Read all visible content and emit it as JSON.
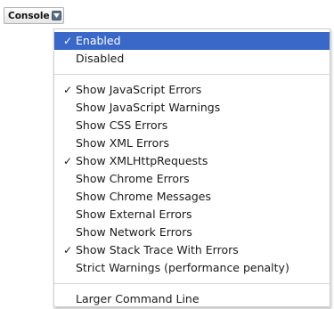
{
  "console_tab": {
    "label": "Console"
  },
  "menu": {
    "group1": [
      {
        "label": "Enabled",
        "checked": true,
        "highlighted": true
      },
      {
        "label": "Disabled",
        "checked": false
      }
    ],
    "group2": [
      {
        "label": "Show JavaScript Errors",
        "checked": true
      },
      {
        "label": "Show JavaScript Warnings",
        "checked": false
      },
      {
        "label": "Show CSS Errors",
        "checked": false
      },
      {
        "label": "Show XML Errors",
        "checked": false
      },
      {
        "label": "Show XMLHttpRequests",
        "checked": true
      },
      {
        "label": "Show Chrome Errors",
        "checked": false
      },
      {
        "label": "Show Chrome Messages",
        "checked": false
      },
      {
        "label": "Show External Errors",
        "checked": false
      },
      {
        "label": "Show Network Errors",
        "checked": false
      },
      {
        "label": "Show Stack Trace With Errors",
        "checked": true
      },
      {
        "label": "Strict Warnings (performance penalty)",
        "checked": false
      }
    ],
    "group3": [
      {
        "label": "Larger Command Line",
        "checked": false
      }
    ],
    "check_glyph": "✓"
  },
  "colors": {
    "highlight": "#3a68c9",
    "dropdown_icon": "#5a6f86"
  }
}
